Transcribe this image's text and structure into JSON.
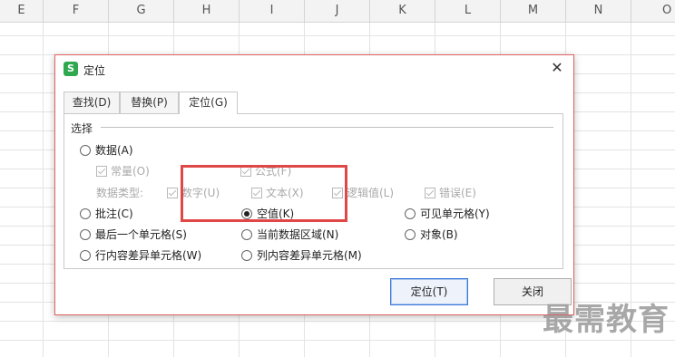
{
  "sheet": {
    "columns": [
      "E",
      "F",
      "G",
      "H",
      "I",
      "J",
      "K",
      "L",
      "M",
      "N",
      "O"
    ]
  },
  "dialog": {
    "title": "定位",
    "app_icon": "S",
    "close_glyph": "✕",
    "tabs": [
      "查找(D)",
      "替换(P)",
      "定位(G)"
    ],
    "active_tab": "定位(G)",
    "group_label": "选择",
    "options": {
      "data": "数据(A)",
      "constants": "常量(O)",
      "formulas": "公式(F)",
      "data_type_label": "数据类型:",
      "numbers": "数字(U)",
      "text": "文本(X)",
      "logicals": "逻辑值(L)",
      "errors": "错误(E)",
      "comments": "批注(C)",
      "blanks": "空值(K)",
      "visible_cells": "可见单元格(Y)",
      "last_cell": "最后一个单元格(S)",
      "current_region": "当前数据区域(N)",
      "objects": "对象(B)",
      "row_differences": "行内容差异单元格(W)",
      "column_differences": "列内容差异单元格(M)"
    },
    "selected_option": "空值(K)",
    "buttons": {
      "ok": "定位(T)",
      "close": "关闭"
    }
  },
  "watermark": "最需教育",
  "colors": {
    "highlight_box": "#e04848",
    "app_icon_green": "#2fa84f",
    "primary_button_border": "#3c78d8"
  }
}
